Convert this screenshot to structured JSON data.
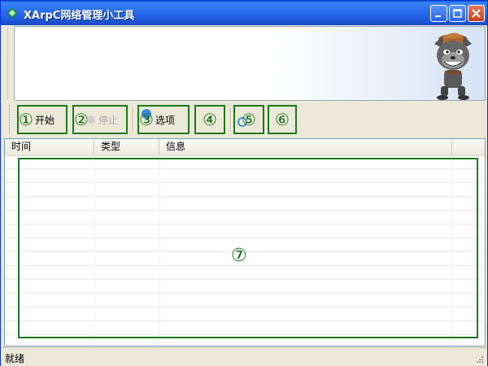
{
  "window": {
    "title": "XArpC网络管理小工具",
    "controls": [
      "minimize",
      "maximize",
      "close"
    ]
  },
  "toolbar": {
    "buttons": [
      {
        "marker": "①",
        "label": "开始",
        "icon": "start-icon",
        "enabled": true
      },
      {
        "marker": "②",
        "label": "停止",
        "icon": "stop-icon",
        "enabled": false
      },
      {
        "marker": "③",
        "label": "选项",
        "icon": "options-icon",
        "enabled": true
      },
      {
        "marker": "④",
        "label": "",
        "icon": "page-icon",
        "enabled": true
      },
      {
        "marker": "⑤",
        "label": "",
        "icon": "refresh-icon",
        "enabled": true
      },
      {
        "marker": "⑥",
        "label": "",
        "icon": "document-icon",
        "enabled": true
      }
    ]
  },
  "list": {
    "columns": [
      "时间",
      "类型",
      "信息"
    ],
    "rows": [],
    "marker": "⑦"
  },
  "status": {
    "text": "就绪"
  },
  "colors": {
    "titlebar": "#1f5fe0",
    "highlight": "#1a7a1a",
    "window_bg": "#ece9d8"
  }
}
